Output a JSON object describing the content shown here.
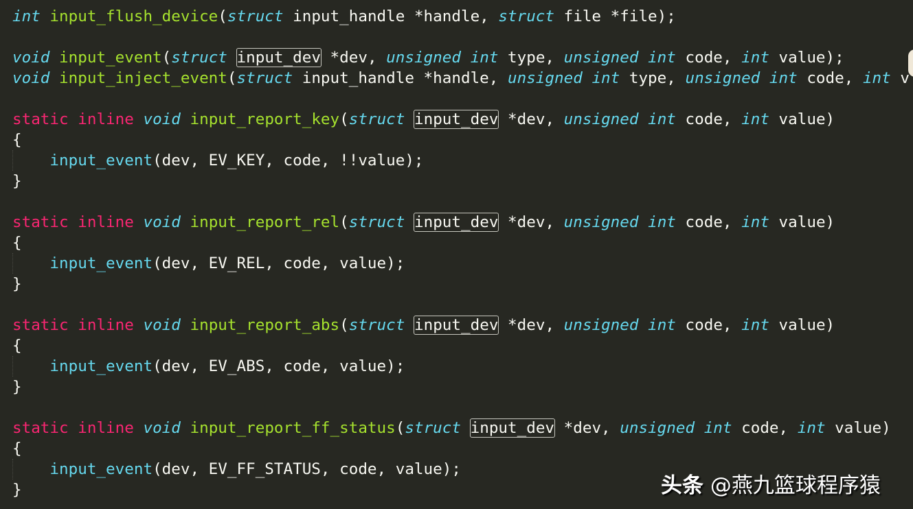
{
  "code_lines": [
    [
      {
        "t": "int",
        "c": "kw-type"
      },
      {
        "t": " "
      },
      {
        "t": "input_flush_device",
        "c": "fn"
      },
      {
        "t": "("
      },
      {
        "t": "struct",
        "c": "kw-type"
      },
      {
        "t": " input_handle *handle, "
      },
      {
        "t": "struct",
        "c": "kw-type"
      },
      {
        "t": " file *file);"
      }
    ],
    [],
    [
      {
        "t": "void",
        "c": "kw-type"
      },
      {
        "t": " "
      },
      {
        "t": "input_event",
        "c": "fn"
      },
      {
        "t": "("
      },
      {
        "t": "struct",
        "c": "kw-type"
      },
      {
        "t": " "
      },
      {
        "t": "input_dev",
        "c": "hl"
      },
      {
        "t": " *dev, "
      },
      {
        "t": "unsigned",
        "c": "kw-type"
      },
      {
        "t": " "
      },
      {
        "t": "int",
        "c": "kw-type"
      },
      {
        "t": " type, "
      },
      {
        "t": "unsigned",
        "c": "kw-type"
      },
      {
        "t": " "
      },
      {
        "t": "int",
        "c": "kw-type"
      },
      {
        "t": " code, "
      },
      {
        "t": "int",
        "c": "kw-type"
      },
      {
        "t": " value);"
      }
    ],
    [
      {
        "t": "void",
        "c": "kw-type"
      },
      {
        "t": " "
      },
      {
        "t": "input_inject_event",
        "c": "fn"
      },
      {
        "t": "("
      },
      {
        "t": "struct",
        "c": "kw-type"
      },
      {
        "t": " input_handle *handle, "
      },
      {
        "t": "unsigned",
        "c": "kw-type"
      },
      {
        "t": " "
      },
      {
        "t": "int",
        "c": "kw-type"
      },
      {
        "t": " type, "
      },
      {
        "t": "unsigned",
        "c": "kw-type"
      },
      {
        "t": " "
      },
      {
        "t": "int",
        "c": "kw-type"
      },
      {
        "t": " code, "
      },
      {
        "t": "int",
        "c": "kw-type"
      },
      {
        "t": " v"
      }
    ],
    [],
    [
      {
        "t": "static",
        "c": "kw-storage"
      },
      {
        "t": " "
      },
      {
        "t": "inline",
        "c": "kw-storage"
      },
      {
        "t": " "
      },
      {
        "t": "void",
        "c": "kw-type"
      },
      {
        "t": " "
      },
      {
        "t": "input_report_key",
        "c": "fn"
      },
      {
        "t": "("
      },
      {
        "t": "struct",
        "c": "kw-type"
      },
      {
        "t": " "
      },
      {
        "t": "input_dev",
        "c": "hl"
      },
      {
        "t": " *dev, "
      },
      {
        "t": "unsigned",
        "c": "kw-type"
      },
      {
        "t": " "
      },
      {
        "t": "int",
        "c": "kw-type"
      },
      {
        "t": " code, "
      },
      {
        "t": "int",
        "c": "kw-type"
      },
      {
        "t": " value)"
      }
    ],
    [
      {
        "t": "{"
      }
    ],
    [
      {
        "t": "    "
      },
      {
        "t": "input_event",
        "c": "call"
      },
      {
        "t": "(dev, EV_KEY, code, !!value);"
      }
    ],
    [
      {
        "t": "}"
      }
    ],
    [],
    [
      {
        "t": "static",
        "c": "kw-storage"
      },
      {
        "t": " "
      },
      {
        "t": "inline",
        "c": "kw-storage"
      },
      {
        "t": " "
      },
      {
        "t": "void",
        "c": "kw-type"
      },
      {
        "t": " "
      },
      {
        "t": "input_report_rel",
        "c": "fn"
      },
      {
        "t": "("
      },
      {
        "t": "struct",
        "c": "kw-type"
      },
      {
        "t": " "
      },
      {
        "t": "input_dev",
        "c": "hl"
      },
      {
        "t": " *dev, "
      },
      {
        "t": "unsigned",
        "c": "kw-type"
      },
      {
        "t": " "
      },
      {
        "t": "int",
        "c": "kw-type"
      },
      {
        "t": " code, "
      },
      {
        "t": "int",
        "c": "kw-type"
      },
      {
        "t": " value)"
      }
    ],
    [
      {
        "t": "{"
      }
    ],
    [
      {
        "t": "    "
      },
      {
        "t": "input_event",
        "c": "call"
      },
      {
        "t": "(dev, EV_REL, code, value);"
      }
    ],
    [
      {
        "t": "}"
      }
    ],
    [],
    [
      {
        "t": "static",
        "c": "kw-storage"
      },
      {
        "t": " "
      },
      {
        "t": "inline",
        "c": "kw-storage"
      },
      {
        "t": " "
      },
      {
        "t": "void",
        "c": "kw-type"
      },
      {
        "t": " "
      },
      {
        "t": "input_report_abs",
        "c": "fn"
      },
      {
        "t": "("
      },
      {
        "t": "struct",
        "c": "kw-type"
      },
      {
        "t": " "
      },
      {
        "t": "input_dev",
        "c": "hl"
      },
      {
        "t": " *dev, "
      },
      {
        "t": "unsigned",
        "c": "kw-type"
      },
      {
        "t": " "
      },
      {
        "t": "int",
        "c": "kw-type"
      },
      {
        "t": " code, "
      },
      {
        "t": "int",
        "c": "kw-type"
      },
      {
        "t": " value)"
      }
    ],
    [
      {
        "t": "{"
      }
    ],
    [
      {
        "t": "    "
      },
      {
        "t": "input_event",
        "c": "call"
      },
      {
        "t": "(dev, EV_ABS, code, value);"
      }
    ],
    [
      {
        "t": "}"
      }
    ],
    [],
    [
      {
        "t": "static",
        "c": "kw-storage"
      },
      {
        "t": " "
      },
      {
        "t": "inline",
        "c": "kw-storage"
      },
      {
        "t": " "
      },
      {
        "t": "void",
        "c": "kw-type"
      },
      {
        "t": " "
      },
      {
        "t": "input_report_ff_status",
        "c": "fn"
      },
      {
        "t": "("
      },
      {
        "t": "struct",
        "c": "kw-type"
      },
      {
        "t": " "
      },
      {
        "t": "input_dev",
        "c": "hl"
      },
      {
        "t": " *dev, "
      },
      {
        "t": "unsigned",
        "c": "kw-type"
      },
      {
        "t": " "
      },
      {
        "t": "int",
        "c": "kw-type"
      },
      {
        "t": " code, "
      },
      {
        "t": "int",
        "c": "kw-type"
      },
      {
        "t": " value)"
      }
    ],
    [
      {
        "t": "{"
      }
    ],
    [
      {
        "t": "    "
      },
      {
        "t": "input_event",
        "c": "call"
      },
      {
        "t": "(dev, EV_FF_STATUS, code, value);"
      }
    ],
    [
      {
        "t": "}"
      }
    ]
  ],
  "watermark": {
    "brand": "头条",
    "handle": " @燕九篮球程序猿"
  },
  "colors": {
    "background": "#272822",
    "type_keyword": "#66d9ef",
    "storage_keyword": "#f92672",
    "function_name": "#a6e22e",
    "text": "#f8f8f2"
  }
}
